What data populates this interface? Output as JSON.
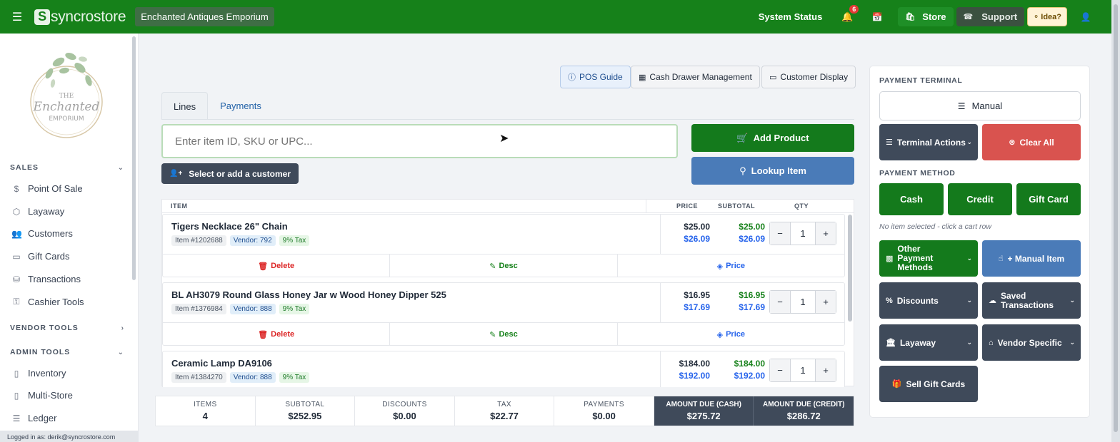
{
  "topbar": {
    "brand_mark": "S",
    "brand_rest": "syncrostore",
    "store_name": "Enchanted Antiques Emporium",
    "system_status": "System Status",
    "notifications_count": "6",
    "store_label": "Store",
    "support_label": "Support",
    "idea_label": "Idea?"
  },
  "sidebar": {
    "logo_text": {
      "line1": "THE",
      "line2": "Enchanted",
      "line3": "EMPORIUM"
    },
    "sales_header": "SALES",
    "sales_items": [
      "Point Of Sale",
      "Layaway",
      "Customers",
      "Gift Cards",
      "Transactions",
      "Cashier Tools"
    ],
    "vendor_header": "VENDOR TOOLS",
    "admin_header": "ADMIN TOOLS",
    "admin_items": [
      "Inventory",
      "Multi-Store",
      "Ledger"
    ],
    "logged_in": "Logged in as: derik@syncrostore.com"
  },
  "toolbar": {
    "pos_guide": "POS Guide",
    "cash_drawer": "Cash Drawer Management",
    "customer_display": "Customer Display"
  },
  "tabs": [
    "Lines",
    "Payments"
  ],
  "search": {
    "placeholder": "Enter item ID, SKU or UPC..."
  },
  "customer_button": "Select or add a customer",
  "add_product": "Add Product",
  "lookup_item": "Lookup Item",
  "table": {
    "headers": {
      "item": "ITEM",
      "price": "PRICE",
      "subtotal": "SUBTOTAL",
      "qty": "QTY"
    },
    "actions": {
      "delete": "Delete",
      "desc": "Desc",
      "price": "Price"
    },
    "rows": [
      {
        "name": "Tigers Necklace 26\" Chain",
        "item_id": "Item #1202688",
        "vendor": "Vendor: 792",
        "tax": "9% Tax",
        "price": "$25.00",
        "price_tax": "$26.09",
        "subtotal": "$25.00",
        "subtotal_tax": "$26.09",
        "qty": "1"
      },
      {
        "name": "BL AH3079 Round Glass Honey Jar w Wood Honey Dipper 525",
        "item_id": "Item #1376984",
        "vendor": "Vendor: 888",
        "tax": "9% Tax",
        "price": "$16.95",
        "price_tax": "$17.69",
        "subtotal": "$16.95",
        "subtotal_tax": "$17.69",
        "qty": "1"
      },
      {
        "name": "Ceramic Lamp DA9106",
        "item_id": "Item #1384270",
        "vendor": "Vendor: 888",
        "tax": "9% Tax",
        "price": "$184.00",
        "price_tax": "$192.00",
        "subtotal": "$184.00",
        "subtotal_tax": "$192.00",
        "qty": "1"
      }
    ]
  },
  "summary": {
    "items": {
      "label": "ITEMS",
      "value": "4"
    },
    "subtotal": {
      "label": "SUBTOTAL",
      "value": "$252.95"
    },
    "discounts": {
      "label": "DISCOUNTS",
      "value": "$0.00"
    },
    "tax": {
      "label": "TAX",
      "value": "$22.77"
    },
    "payments": {
      "label": "PAYMENTS",
      "value": "$0.00"
    },
    "due_cash": {
      "label": "AMOUNT DUE (CASH)",
      "value": "$275.72"
    },
    "due_credit": {
      "label": "AMOUNT DUE (CREDIT)",
      "value": "$286.72"
    }
  },
  "panel": {
    "terminal_label": "PAYMENT TERMINAL",
    "manual": "Manual",
    "terminal_actions": "Terminal Actions",
    "clear_all": "Clear All",
    "method_label": "PAYMENT METHOD",
    "cash": "Cash",
    "credit": "Credit",
    "gift_card": "Gift Card",
    "hint": "No item selected - click a cart row",
    "other_methods": "Other Payment Methods",
    "manual_item": "+ Manual Item",
    "discounts": "Discounts",
    "saved_transactions": "Saved Transactions",
    "layaway": "Layaway",
    "vendor_specific": "Vendor Specific",
    "sell_gift_cards": "Sell Gift Cards"
  },
  "colors": {
    "brand_green": "#16811a",
    "dark_slate": "#3f4a5a",
    "blue": "#4a7bb8",
    "red": "#d9534f"
  }
}
